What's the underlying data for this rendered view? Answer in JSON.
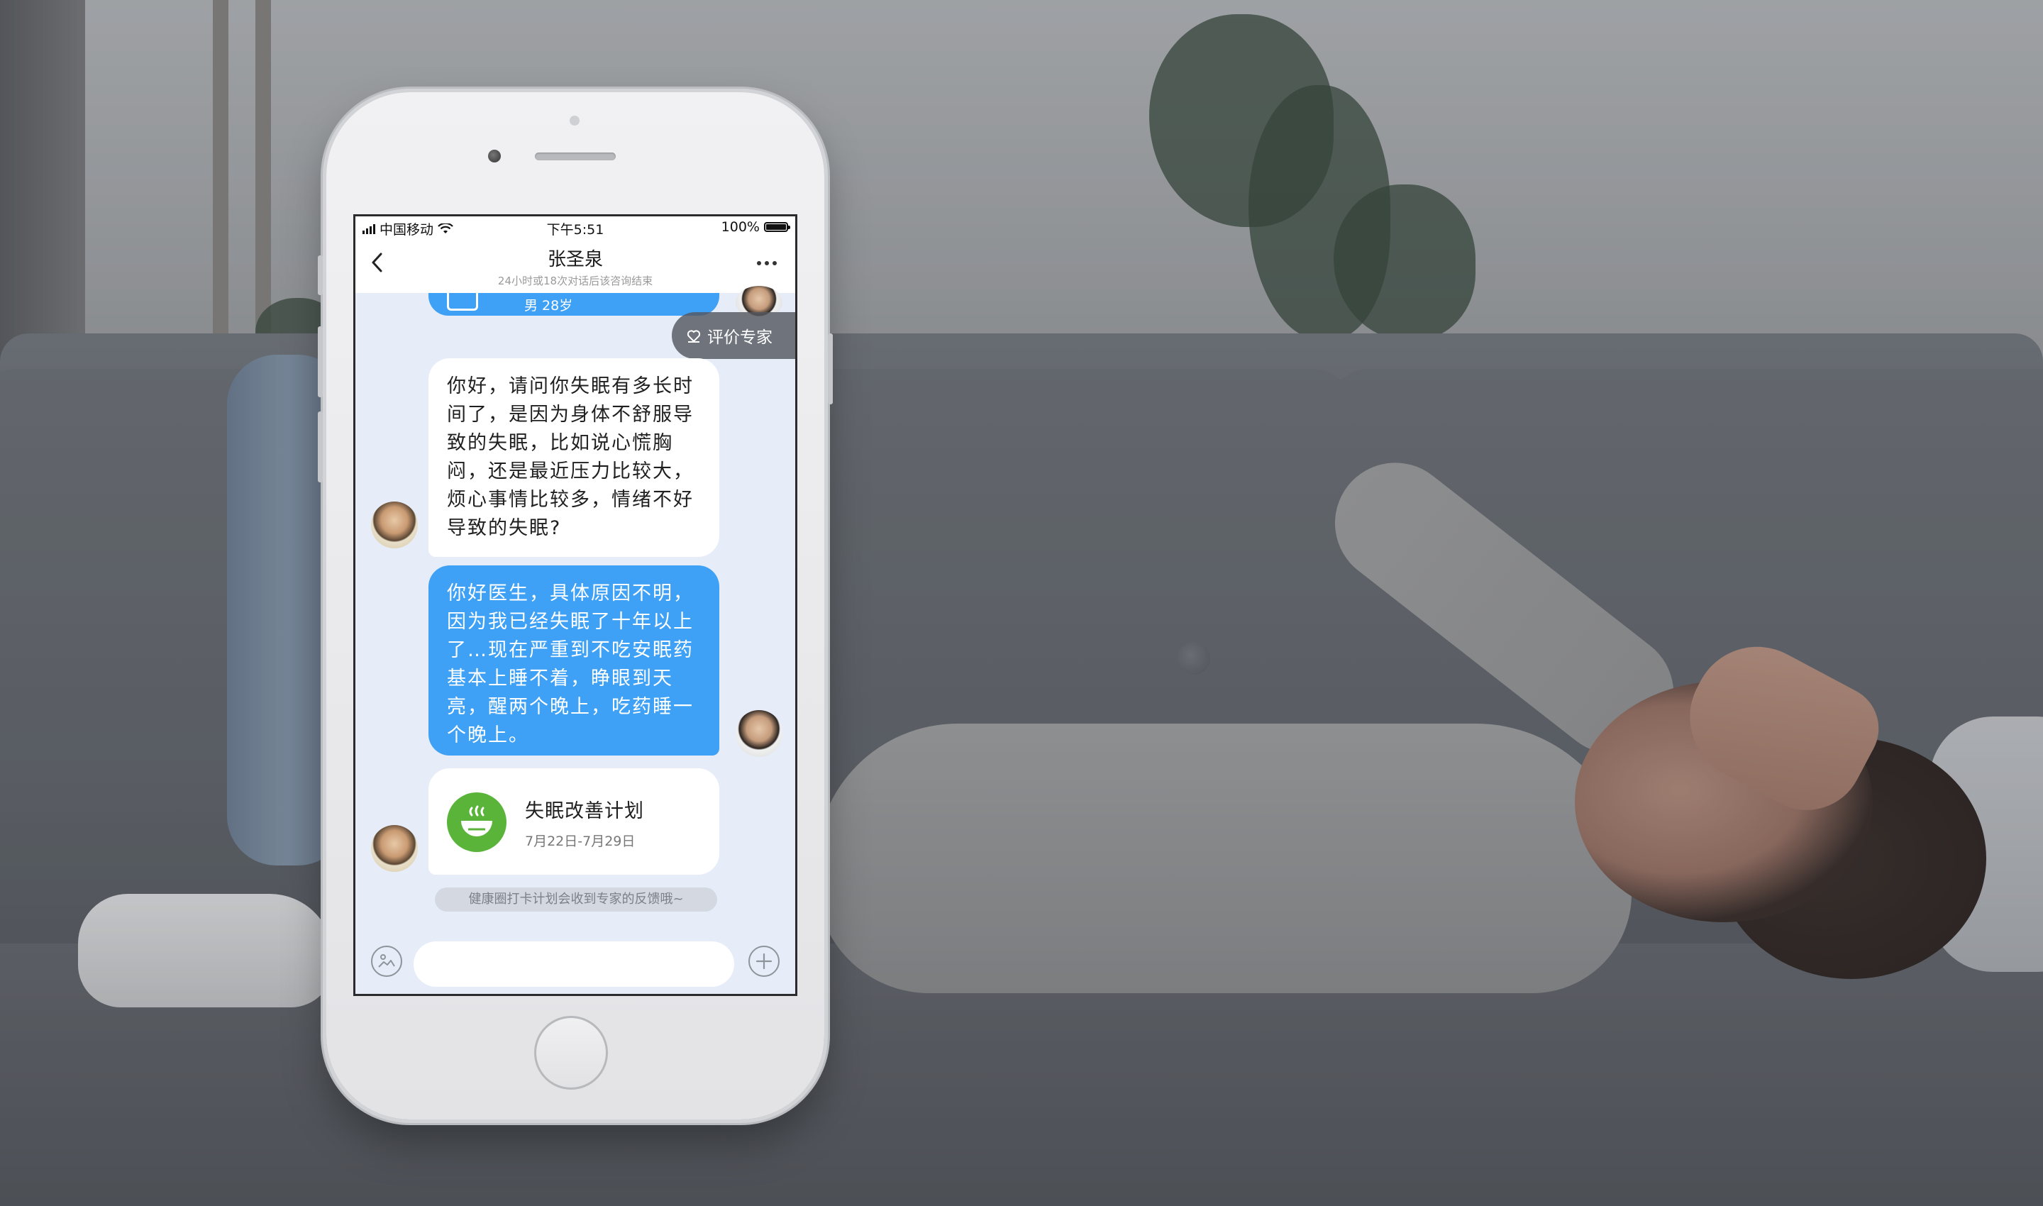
{
  "statusbar": {
    "carrier": "中国移动",
    "time": "下午5:51",
    "battery": "100%"
  },
  "navbar": {
    "title": "张圣泉",
    "subtitle": "24小时或18次对话后该咨询结束",
    "back_icon": "chevron-left-icon",
    "more_icon": "more-dots-icon"
  },
  "chat": {
    "top_card_meta": "男 28岁",
    "rate_button": "评价专家",
    "messages": [
      {
        "side": "left",
        "sender": "doctor",
        "text": "你好，请问你失眠有多长时\n间了，是因为身体不舒服导\n致的失眠，比如说心慌胸\n闷，还是最近压力比较大，\n烦心事情比较多，情绪不好\n导致的失眠?"
      },
      {
        "side": "right",
        "sender": "patient",
        "text": "你好医生，具体原因不明，\n因为我已经失眠了十年以上\n了…现在严重到不吃安眠药\n基本上睡不着，睁眼到天\n亮，醒两个晚上，吃药睡一\n个晚上。"
      }
    ],
    "plan_card": {
      "title": "失眠改善计划",
      "date": "7月22日-7月29日",
      "icon": "bowl-icon",
      "accent": "#5ab43a"
    },
    "notice": "健康圈打卡计划会收到专家的反馈哦~"
  },
  "inputbar": {
    "value": "",
    "left_icon": "image-icon",
    "right_icon": "plus-icon"
  },
  "colors": {
    "bubble_blue": "#3fa1f6",
    "chat_bg": "#e6edf8"
  }
}
